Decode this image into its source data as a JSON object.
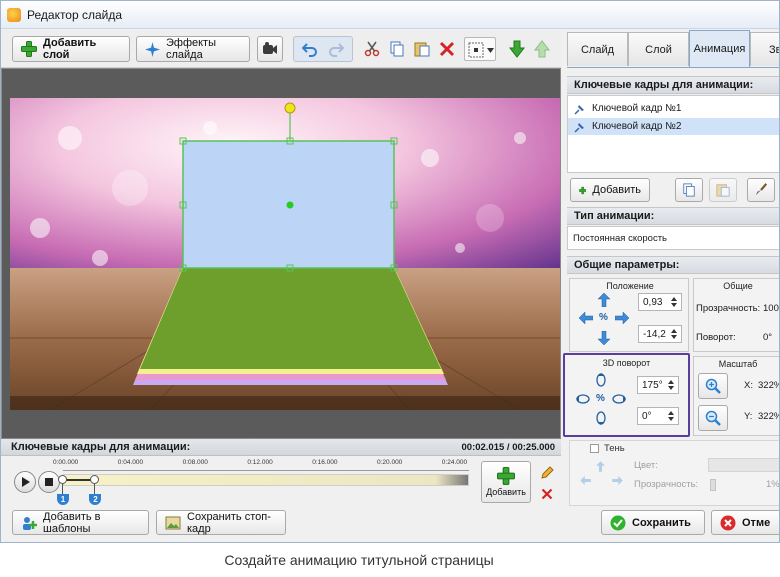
{
  "window": {
    "title": "Редактор слайда"
  },
  "toolbar": {
    "add_layer_label": "Добавить слой",
    "effects_label": "Эффекты слайда"
  },
  "tabs": [
    {
      "label": "Слайд",
      "active": false
    },
    {
      "label": "Слой",
      "active": false
    },
    {
      "label": "Анимация",
      "active": true
    },
    {
      "label": "Зв",
      "active": false
    }
  ],
  "keyframes_panel": {
    "header": "Ключевые кадры для анимации:",
    "items": [
      "Ключевой кадр №1",
      "Ключевой кадр №2"
    ],
    "add_label": "Добавить"
  },
  "animation_type": {
    "header": "Тип анимации:",
    "value": "Постоянная скорость"
  },
  "general": {
    "header": "Общие параметры:",
    "position_title": "Положение",
    "position_x": "0,93",
    "position_y": "-14,2",
    "common_title": "Общие",
    "opacity_label": "Прозрачность:",
    "opacity_value": "100%",
    "rotation_label": "Поворот:",
    "rotation_value": "0°",
    "rotate3d_title": "3D поворот",
    "rotate3d_a": "175°",
    "rotate3d_b": "0°",
    "scale_title": "Масштаб",
    "scale_x_label": "X:",
    "scale_x_value": "322%",
    "scale_y_label": "Y:",
    "scale_y_value": "322%"
  },
  "shadow": {
    "checkbox_label": "Тень",
    "color_label": "Цвет:",
    "opacity_label": "Прозрачность:",
    "opacity_value": "1%"
  },
  "timeline": {
    "title": "Ключевые кадры для анимации:",
    "time_display": "00:02.015 / 00:25.000",
    "ticks": [
      "0:00.000",
      "0:04.000",
      "0:08.000",
      "0:12.000",
      "0:16.000",
      "0:20.000",
      "0:24.000"
    ],
    "markers": [
      "1",
      "2"
    ],
    "marker_positions_pct": [
      0,
      8
    ],
    "add_label": "Добавить"
  },
  "footer": {
    "add_template_label": "Добавить в шаблоны",
    "save_frame_label": "Сохранить стоп-кадр",
    "save_label": "Сохранить",
    "cancel_label": "Отме"
  },
  "caption": "Создайте анимацию титульной страницы",
  "colors": {
    "accent_purple": "#5c3d9e",
    "selection_blue": "#cfe2f8",
    "canvas_rect": "#bcd4f5",
    "canvas_green": "#6e9e2c"
  }
}
